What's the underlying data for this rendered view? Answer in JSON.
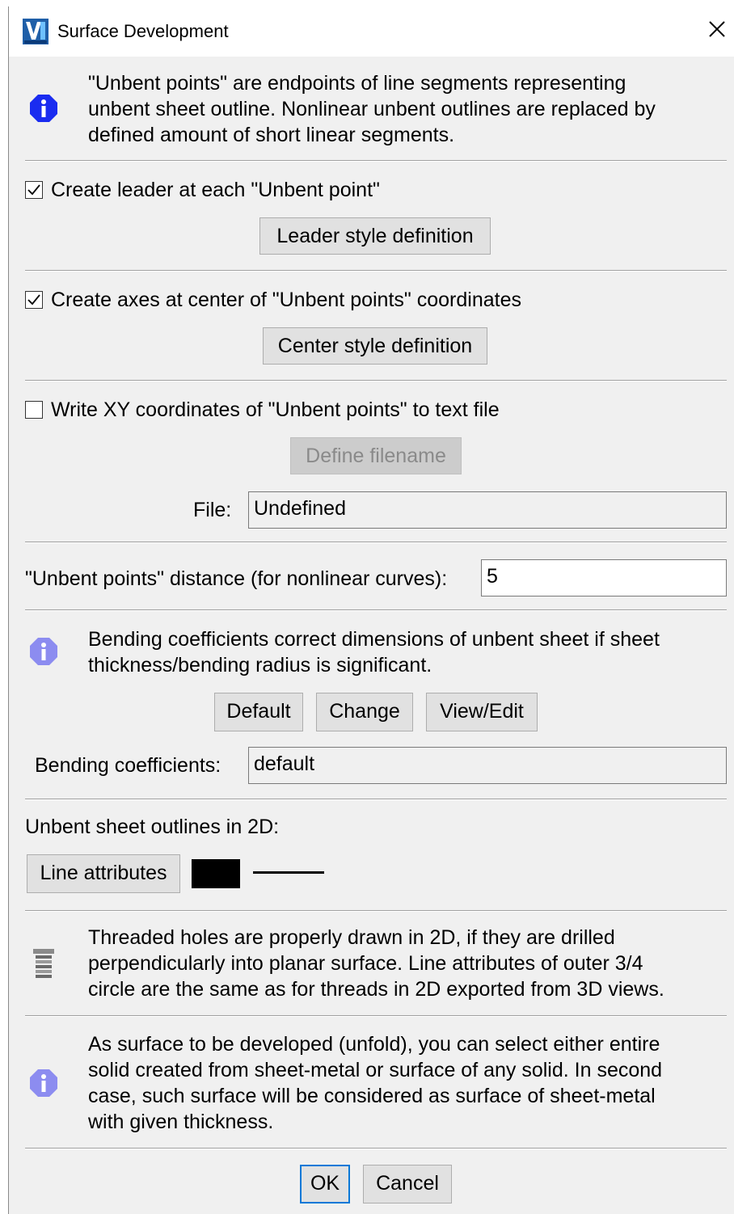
{
  "window": {
    "title": "Surface Development",
    "icon": "vericad-logo-icon"
  },
  "info1": {
    "text": [
      "\"Unbent points\" are endpoints of line segments representing",
      "unbent sheet outline. Nonlinear unbent outlines are replaced by",
      "defined amount of short linear segments."
    ]
  },
  "leader": {
    "checkbox_label": "Create leader at each \"Unbent point\"",
    "checked": true,
    "button": "Leader style definition"
  },
  "axes": {
    "checkbox_label": "Create axes at center of \"Unbent points\" coordinates",
    "checked": true,
    "button": "Center style definition"
  },
  "xyfile": {
    "checkbox_label": "Write XY coordinates of \"Unbent points\" to text file",
    "checked": false,
    "button": "Define filename",
    "file_label": "File:",
    "file_value": "Undefined"
  },
  "distance": {
    "label": "\"Unbent points\" distance (for nonlinear curves):",
    "value": "5"
  },
  "info2": {
    "text": [
      "Bending coefficients correct dimensions of unbent sheet if sheet",
      "thickness/bending radius is significant."
    ]
  },
  "bending": {
    "buttons": [
      "Default",
      "Change",
      "View/Edit"
    ],
    "label": "Bending coefficients:",
    "value": "default"
  },
  "outlines": {
    "label": "Unbent sheet outlines in 2D:",
    "button": "Line attributes",
    "color": "#000000"
  },
  "info3": {
    "text": [
      "Threaded holes are properly drawn in 2D, if they are drilled",
      "perpendicularly into planar surface. Line attributes of outer 3/4",
      "circle are the same as for threads in 2D exported from 3D views."
    ]
  },
  "info4": {
    "text": [
      "As surface to be developed (unfold), you can select either entire",
      "solid created from sheet-metal or surface of any solid. In second",
      "case, such surface will be considered as surface of sheet-metal",
      "with given thickness."
    ]
  },
  "footer": {
    "ok": "OK",
    "cancel": "Cancel"
  },
  "colors": {
    "info_blue": "#1a2cf0",
    "info_light": "#8c8cf0",
    "focus_border": "#0078d7"
  }
}
